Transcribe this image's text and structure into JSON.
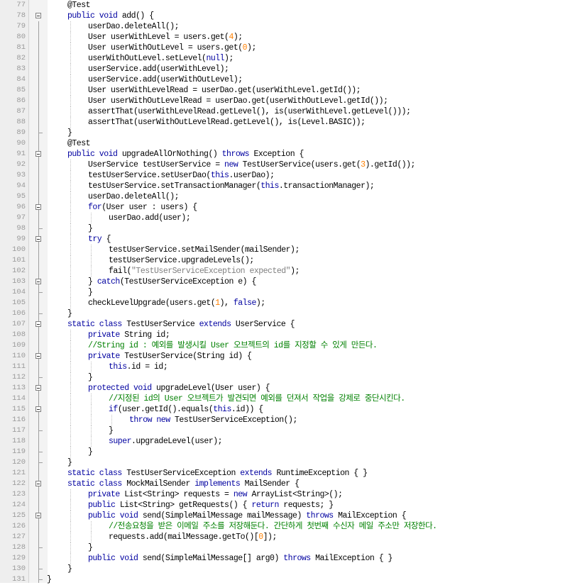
{
  "editor": {
    "colors": {
      "code": "#000000",
      "keyword": "#0000a0",
      "number": "#ff8000",
      "string": "#808080",
      "comment": "#008000",
      "line_number": "#9a9a9a"
    },
    "lines": [
      {
        "n": "77",
        "fold": "none",
        "indent": 1,
        "tokens": [
          {
            "t": "@Test",
            "c": "ann"
          }
        ]
      },
      {
        "n": "78",
        "fold": "open",
        "indent": 1,
        "tokens": [
          {
            "t": "public void",
            "c": "kw"
          },
          {
            "t": " add() {",
            "c": "code"
          }
        ]
      },
      {
        "n": "79",
        "fold": "none",
        "indent": 2,
        "tokens": [
          {
            "t": "userDao.deleteAll();",
            "c": "code"
          }
        ]
      },
      {
        "n": "80",
        "fold": "none",
        "indent": 2,
        "tokens": [
          {
            "t": "User userWithLevel = users.get(",
            "c": "code"
          },
          {
            "t": "4",
            "c": "num"
          },
          {
            "t": ");",
            "c": "code"
          }
        ]
      },
      {
        "n": "81",
        "fold": "none",
        "indent": 2,
        "tokens": [
          {
            "t": "User userWithOutLevel = users.get(",
            "c": "code"
          },
          {
            "t": "0",
            "c": "num"
          },
          {
            "t": ");",
            "c": "code"
          }
        ]
      },
      {
        "n": "82",
        "fold": "none",
        "indent": 2,
        "tokens": [
          {
            "t": "userWithOutLevel.setLevel(",
            "c": "code"
          },
          {
            "t": "null",
            "c": "kw"
          },
          {
            "t": ");",
            "c": "code"
          }
        ]
      },
      {
        "n": "83",
        "fold": "none",
        "indent": 2,
        "tokens": [
          {
            "t": "userService.add(userWithLevel);",
            "c": "code"
          }
        ]
      },
      {
        "n": "84",
        "fold": "none",
        "indent": 2,
        "tokens": [
          {
            "t": "userService.add(userWithOutLevel);",
            "c": "code"
          }
        ]
      },
      {
        "n": "85",
        "fold": "none",
        "indent": 2,
        "tokens": [
          {
            "t": "User userWithLevelRead = userDao.get(userWithLevel.getId());",
            "c": "code"
          }
        ]
      },
      {
        "n": "86",
        "fold": "none",
        "indent": 2,
        "tokens": [
          {
            "t": "User userWithOutLevelRead = userDao.get(userWithOutLevel.getId());",
            "c": "code"
          }
        ]
      },
      {
        "n": "87",
        "fold": "none",
        "indent": 2,
        "tokens": [
          {
            "t": "assertThat(userWithLevelRead.getLevel(), is(userWithLevel.getLevel()));",
            "c": "code"
          }
        ]
      },
      {
        "n": "88",
        "fold": "none",
        "indent": 2,
        "tokens": [
          {
            "t": "assertThat(userWithOutLevelRead.getLevel(), is(Level.BASIC));",
            "c": "code"
          }
        ]
      },
      {
        "n": "89",
        "fold": "end",
        "indent": 1,
        "tokens": [
          {
            "t": "}",
            "c": "code"
          }
        ]
      },
      {
        "n": "90",
        "fold": "none",
        "indent": 1,
        "tokens": [
          {
            "t": "@Test",
            "c": "ann"
          }
        ]
      },
      {
        "n": "91",
        "fold": "open",
        "indent": 1,
        "tokens": [
          {
            "t": "public void",
            "c": "kw"
          },
          {
            "t": " upgradeAllOrNothing() ",
            "c": "code"
          },
          {
            "t": "throws",
            "c": "kw"
          },
          {
            "t": " Exception {",
            "c": "code"
          }
        ]
      },
      {
        "n": "92",
        "fold": "none",
        "indent": 2,
        "tokens": [
          {
            "t": "UserService testUserService = ",
            "c": "code"
          },
          {
            "t": "new",
            "c": "kw"
          },
          {
            "t": " TestUserService(users.get(",
            "c": "code"
          },
          {
            "t": "3",
            "c": "num"
          },
          {
            "t": ").getId());",
            "c": "code"
          }
        ]
      },
      {
        "n": "93",
        "fold": "none",
        "indent": 2,
        "tokens": [
          {
            "t": "testUserService.setUserDao(",
            "c": "code"
          },
          {
            "t": "this",
            "c": "kw"
          },
          {
            "t": ".userDao);",
            "c": "code"
          }
        ]
      },
      {
        "n": "94",
        "fold": "none",
        "indent": 2,
        "tokens": [
          {
            "t": "testUserService.setTransactionManager(",
            "c": "code"
          },
          {
            "t": "this",
            "c": "kw"
          },
          {
            "t": ".transactionManager);",
            "c": "code"
          }
        ]
      },
      {
        "n": "95",
        "fold": "none",
        "indent": 2,
        "tokens": [
          {
            "t": "userDao.deleteAll();",
            "c": "code"
          }
        ]
      },
      {
        "n": "96",
        "fold": "open",
        "indent": 2,
        "tokens": [
          {
            "t": "for",
            "c": "kw"
          },
          {
            "t": "(User user : users) {",
            "c": "code"
          }
        ]
      },
      {
        "n": "97",
        "fold": "none",
        "indent": 3,
        "tokens": [
          {
            "t": "userDao.add(user);",
            "c": "code"
          }
        ]
      },
      {
        "n": "98",
        "fold": "end",
        "indent": 2,
        "tokens": [
          {
            "t": "}",
            "c": "code"
          }
        ]
      },
      {
        "n": "99",
        "fold": "open",
        "indent": 2,
        "tokens": [
          {
            "t": "try",
            "c": "kw"
          },
          {
            "t": " {",
            "c": "code"
          }
        ]
      },
      {
        "n": "100",
        "fold": "none",
        "indent": 3,
        "tokens": [
          {
            "t": "testUserService.setMailSender(mailSender);",
            "c": "code"
          }
        ]
      },
      {
        "n": "101",
        "fold": "none",
        "indent": 3,
        "tokens": [
          {
            "t": "testUserService.upgradeLevels();",
            "c": "code"
          }
        ]
      },
      {
        "n": "102",
        "fold": "none",
        "indent": 3,
        "tokens": [
          {
            "t": "fail(",
            "c": "code"
          },
          {
            "t": "\"TestUserServiceException expected\"",
            "c": "str"
          },
          {
            "t": ");",
            "c": "code"
          }
        ]
      },
      {
        "n": "103",
        "fold": "open",
        "indent": 2,
        "tokens": [
          {
            "t": "} ",
            "c": "code"
          },
          {
            "t": "catch",
            "c": "kw"
          },
          {
            "t": "(TestUserServiceException e) {",
            "c": "code"
          }
        ]
      },
      {
        "n": "104",
        "fold": "end",
        "indent": 2,
        "tokens": [
          {
            "t": "}",
            "c": "code"
          }
        ]
      },
      {
        "n": "105",
        "fold": "none",
        "indent": 2,
        "tokens": [
          {
            "t": "checkLevelUpgrade(users.get(",
            "c": "code"
          },
          {
            "t": "1",
            "c": "num"
          },
          {
            "t": "), ",
            "c": "code"
          },
          {
            "t": "false",
            "c": "kw"
          },
          {
            "t": ");",
            "c": "code"
          }
        ]
      },
      {
        "n": "106",
        "fold": "end",
        "indent": 1,
        "tokens": [
          {
            "t": "}",
            "c": "code"
          }
        ]
      },
      {
        "n": "107",
        "fold": "open",
        "indent": 1,
        "tokens": [
          {
            "t": "static class",
            "c": "kw"
          },
          {
            "t": " TestUserService ",
            "c": "code"
          },
          {
            "t": "extends",
            "c": "kw"
          },
          {
            "t": " UserService {",
            "c": "code"
          }
        ]
      },
      {
        "n": "108",
        "fold": "none",
        "indent": 2,
        "tokens": [
          {
            "t": "private",
            "c": "kw"
          },
          {
            "t": " String id;",
            "c": "code"
          }
        ]
      },
      {
        "n": "109",
        "fold": "none",
        "indent": 2,
        "tokens": [
          {
            "t": "//String id : 예외를 발생시킬 User 오브젝트의 id를 지정할 수 있게 만든다.",
            "c": "cmt"
          }
        ]
      },
      {
        "n": "110",
        "fold": "open",
        "indent": 2,
        "tokens": [
          {
            "t": "private",
            "c": "kw"
          },
          {
            "t": " TestUserService(String id) {",
            "c": "code"
          }
        ]
      },
      {
        "n": "111",
        "fold": "none",
        "indent": 3,
        "tokens": [
          {
            "t": "this",
            "c": "kw"
          },
          {
            "t": ".id = id;",
            "c": "code"
          }
        ]
      },
      {
        "n": "112",
        "fold": "end",
        "indent": 2,
        "tokens": [
          {
            "t": "}",
            "c": "code"
          }
        ]
      },
      {
        "n": "113",
        "fold": "open",
        "indent": 2,
        "tokens": [
          {
            "t": "protected void",
            "c": "kw"
          },
          {
            "t": " upgradeLevel(User user) {",
            "c": "code"
          }
        ]
      },
      {
        "n": "114",
        "fold": "none",
        "indent": 3,
        "tokens": [
          {
            "t": "//지정된 id의 User 오브젝트가 발견되면 예외를 던져서 작업을 강제로 중단시킨다.",
            "c": "cmt"
          }
        ]
      },
      {
        "n": "115",
        "fold": "open",
        "indent": 3,
        "tokens": [
          {
            "t": "if",
            "c": "kw"
          },
          {
            "t": "(user.getId().equals(",
            "c": "code"
          },
          {
            "t": "this",
            "c": "kw"
          },
          {
            "t": ".id)) {",
            "c": "code"
          }
        ]
      },
      {
        "n": "116",
        "fold": "none",
        "indent": 4,
        "tokens": [
          {
            "t": "throw new",
            "c": "kw"
          },
          {
            "t": " TestUserServiceException();",
            "c": "code"
          }
        ]
      },
      {
        "n": "117",
        "fold": "end",
        "indent": 3,
        "tokens": [
          {
            "t": "}",
            "c": "code"
          }
        ]
      },
      {
        "n": "118",
        "fold": "none",
        "indent": 3,
        "tokens": [
          {
            "t": "super",
            "c": "kw"
          },
          {
            "t": ".upgradeLevel(user);",
            "c": "code"
          }
        ]
      },
      {
        "n": "119",
        "fold": "end",
        "indent": 2,
        "tokens": [
          {
            "t": "}",
            "c": "code"
          }
        ]
      },
      {
        "n": "120",
        "fold": "end",
        "indent": 1,
        "tokens": [
          {
            "t": "}",
            "c": "code"
          }
        ]
      },
      {
        "n": "121",
        "fold": "none",
        "indent": 1,
        "tokens": [
          {
            "t": "static class",
            "c": "kw"
          },
          {
            "t": " TestUserServiceException ",
            "c": "code"
          },
          {
            "t": "extends",
            "c": "kw"
          },
          {
            "t": " RuntimeException { }",
            "c": "code"
          }
        ]
      },
      {
        "n": "122",
        "fold": "open",
        "indent": 1,
        "tokens": [
          {
            "t": "static class",
            "c": "kw"
          },
          {
            "t": " MockMailSender ",
            "c": "code"
          },
          {
            "t": "implements",
            "c": "kw"
          },
          {
            "t": " MailSender {",
            "c": "code"
          }
        ]
      },
      {
        "n": "123",
        "fold": "none",
        "indent": 2,
        "tokens": [
          {
            "t": "private",
            "c": "kw"
          },
          {
            "t": " List<String> requests = ",
            "c": "code"
          },
          {
            "t": "new",
            "c": "kw"
          },
          {
            "t": " ArrayList<String>();",
            "c": "code"
          }
        ]
      },
      {
        "n": "124",
        "fold": "none",
        "indent": 2,
        "tokens": [
          {
            "t": "public",
            "c": "kw"
          },
          {
            "t": " List<String> getRequests() { ",
            "c": "code"
          },
          {
            "t": "return",
            "c": "kw"
          },
          {
            "t": " requests; }",
            "c": "code"
          }
        ]
      },
      {
        "n": "125",
        "fold": "open",
        "indent": 2,
        "tokens": [
          {
            "t": "public void",
            "c": "kw"
          },
          {
            "t": " send(SimpleMailMessage mailMessage) ",
            "c": "code"
          },
          {
            "t": "throws",
            "c": "kw"
          },
          {
            "t": " MailException {",
            "c": "code"
          }
        ]
      },
      {
        "n": "126",
        "fold": "none",
        "indent": 3,
        "tokens": [
          {
            "t": "//전송요청을 받은 이메일 주소를 저장해둔다. 간단하게 첫번째 수신자 메일 주소만 저장한다.",
            "c": "cmt"
          }
        ]
      },
      {
        "n": "127",
        "fold": "none",
        "indent": 3,
        "tokens": [
          {
            "t": "requests.add(mailMessage.getTo()[",
            "c": "code"
          },
          {
            "t": "0",
            "c": "num"
          },
          {
            "t": "]);",
            "c": "code"
          }
        ]
      },
      {
        "n": "128",
        "fold": "end",
        "indent": 2,
        "tokens": [
          {
            "t": "}",
            "c": "code"
          }
        ]
      },
      {
        "n": "129",
        "fold": "none",
        "indent": 2,
        "tokens": [
          {
            "t": "public void",
            "c": "kw"
          },
          {
            "t": " send(SimpleMailMessage[] arg0) ",
            "c": "code"
          },
          {
            "t": "throws",
            "c": "kw"
          },
          {
            "t": " MailException { }",
            "c": "code"
          }
        ]
      },
      {
        "n": "130",
        "fold": "end",
        "indent": 1,
        "tokens": [
          {
            "t": "}",
            "c": "code"
          }
        ]
      },
      {
        "n": "131",
        "fold": "end",
        "indent": 0,
        "tokens": [
          {
            "t": "}",
            "c": "code"
          }
        ]
      }
    ]
  }
}
